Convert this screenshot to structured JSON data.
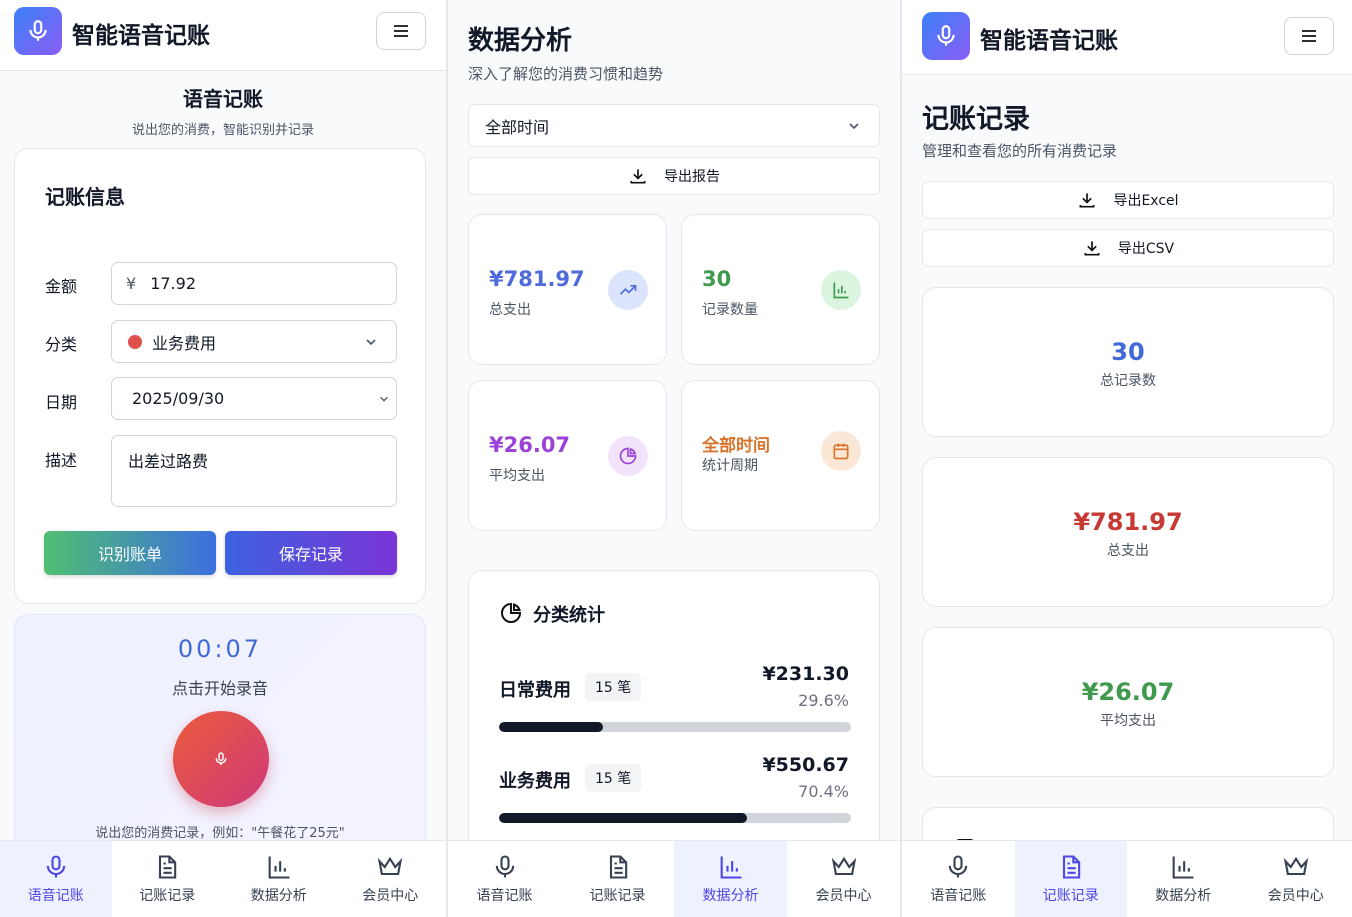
{
  "app_title": "智能语音记账",
  "nav": [
    "语音记账",
    "记账记录",
    "数据分析",
    "会员中心"
  ],
  "voice": {
    "page_title": "语音记账",
    "page_subtitle": "说出您的消费，智能识别并记录",
    "card_title": "记账信息",
    "amount_label": "金额",
    "currency": "¥",
    "amount_value": "17.92",
    "category_label": "分类",
    "category_value": "业务费用",
    "category_color": "#e0524d",
    "date_label": "日期",
    "date_value": "2025/09/30",
    "desc_label": "描述",
    "desc_value": "出差过路费",
    "recognize_button": "识别账单",
    "save_button": "保存记录",
    "timer": "00:07",
    "record_hint": "点击开始录音",
    "example_text": "说出您的消费记录，例如：\"午餐花了25元\""
  },
  "analysis": {
    "title": "数据分析",
    "subtitle": "深入了解您的消费习惯和趋势",
    "period_select": "全部时间",
    "export_button": "导出报告",
    "stats": [
      {
        "value": "¥781.97",
        "label": "总支出",
        "color": "#4f6bdb",
        "icon": "trending-up-icon",
        "bg": "#dbe4fb"
      },
      {
        "value": "30",
        "label": "记录数量",
        "color": "#3f9a4e",
        "icon": "bar-chart-icon",
        "bg": "#dcf5e1"
      },
      {
        "value": "¥26.07",
        "label": "平均支出",
        "color": "#9b43d8",
        "icon": "pie-chart-icon",
        "bg": "#f1e3fb"
      },
      {
        "value": "全部时间",
        "label": "统计周期",
        "color": "#d9742c",
        "icon": "calendar-icon",
        "bg": "#fbe7d6"
      }
    ],
    "category_title": "分类统计",
    "categories": [
      {
        "name": "日常费用",
        "count": "15 笔",
        "amount": "¥231.30",
        "percent": "29.6%",
        "ratio": 0.296
      },
      {
        "name": "业务费用",
        "count": "15 笔",
        "amount": "¥550.67",
        "percent": "70.4%",
        "ratio": 0.704
      }
    ]
  },
  "records": {
    "title": "记账记录",
    "subtitle": "管理和查看您的所有消费记录",
    "export_excel": "导出Excel",
    "export_csv": "导出CSV",
    "summary": [
      {
        "value": "30",
        "label": "总记录数",
        "color": "#4169d8"
      },
      {
        "value": "¥781.97",
        "label": "总支出",
        "color": "#c73a34"
      },
      {
        "value": "¥26.07",
        "label": "平均支出",
        "color": "#3f9a4e"
      }
    ]
  }
}
